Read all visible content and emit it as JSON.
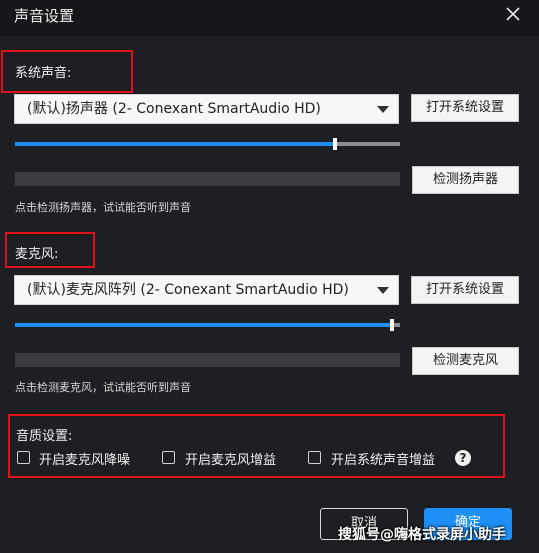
{
  "dialog": {
    "title": "声音设置"
  },
  "system_sound": {
    "label": "系统声音:",
    "device": "(默认)扬声器 (2- Conexant SmartAudio HD)",
    "open_settings": "打开系统设置",
    "volume_fraction": 0.83,
    "test_button": "检测扬声器",
    "hint": "点击检测扬声器，试试能否听到声音"
  },
  "microphone": {
    "label": "麦克风:",
    "device": "(默认)麦克风阵列 (2- Conexant SmartAudio HD)",
    "open_settings": "打开系统设置",
    "volume_fraction": 0.98,
    "test_button": "检测麦克风",
    "hint": "点击检测麦克风，试试能否听到声音"
  },
  "quality": {
    "label": "音质设置:",
    "options": [
      {
        "label": "开启麦克风降噪",
        "checked": false
      },
      {
        "label": "开启麦克风增益",
        "checked": false
      },
      {
        "label": "开启系统声音增益",
        "checked": false
      }
    ],
    "help_icon": "question-circle-icon"
  },
  "footer": {
    "cancel": "取消",
    "ok": "确定"
  },
  "watermark": "搜狐号@嗨格式录屏小助手",
  "colors": {
    "accent": "#1e8ff5",
    "highlight_box": "#e01018",
    "background": "#1e1f24"
  }
}
